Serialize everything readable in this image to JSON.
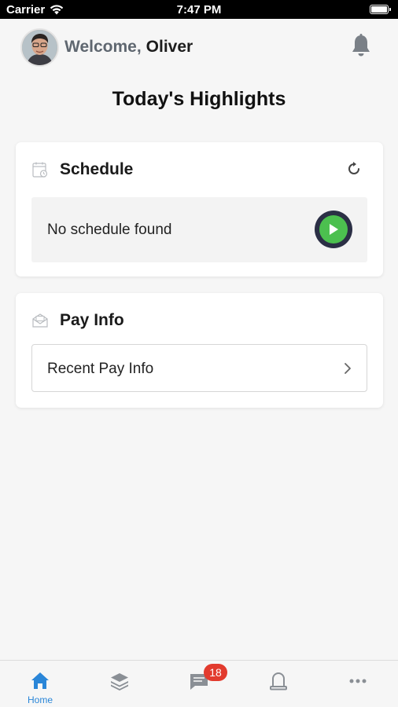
{
  "status_bar": {
    "carrier": "Carrier",
    "time": "7:47 PM"
  },
  "header": {
    "welcome_label": "Welcome,",
    "user_name": "Oliver"
  },
  "page_title": "Today's Highlights",
  "schedule": {
    "title": "Schedule",
    "empty_text": "No schedule found"
  },
  "pay_info": {
    "title": "Pay Info",
    "row_label": "Recent Pay Info"
  },
  "tab_bar": {
    "home_label": "Home",
    "messages_badge": "18"
  },
  "colors": {
    "accent_blue": "#2a86d8",
    "play_green": "#4cc04f",
    "badge_red": "#e23b2e"
  }
}
